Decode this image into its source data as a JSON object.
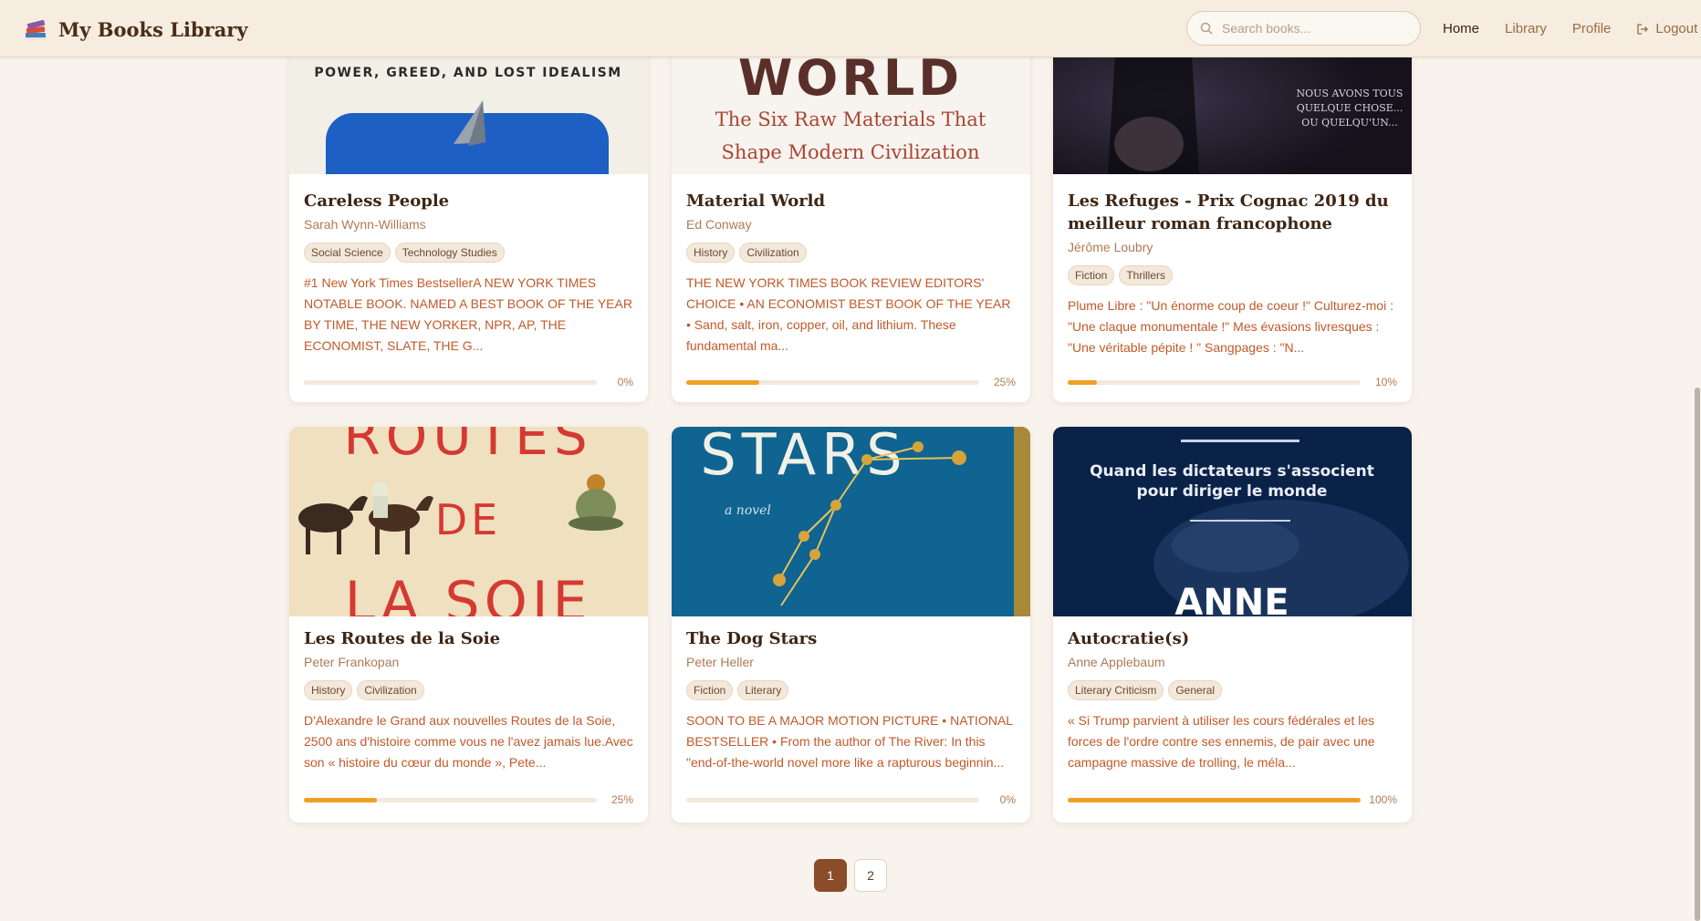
{
  "app": {
    "title": "My Books Library"
  },
  "search": {
    "placeholder": "Search books..."
  },
  "nav": [
    {
      "label": "Home",
      "active": true
    },
    {
      "label": "Library",
      "active": false
    },
    {
      "label": "Profile",
      "active": false
    },
    {
      "label": "Logout",
      "active": false,
      "icon": "logout-icon"
    }
  ],
  "books": [
    {
      "title": "Careless People",
      "author": "Sarah Wynn-Williams",
      "tags": [
        "Social Science",
        "Technology Studies"
      ],
      "description": "#1 New York Times BestsellerA NEW YORK TIMES NOTABLE BOOK. NAMED A BEST BOOK OF THE YEAR BY TIME, THE NEW YORKER, NPR, AP, THE ECONOMIST, SLATE, THE G...",
      "progress": 0,
      "progress_label": "0%",
      "cover_text": "POWER, GREED, AND LOST IDEALISM"
    },
    {
      "title": "Material World",
      "author": "Ed Conway",
      "tags": [
        "History",
        "Civilization"
      ],
      "description": "THE NEW YORK TIMES BOOK REVIEW EDITORS' CHOICE • AN ECONOMIST BEST BOOK OF THE YEAR • Sand, salt, iron, copper, oil, and lithium. These fundamental ma...",
      "progress": 25,
      "progress_label": "25%",
      "cover_text": "WORLD",
      "cover_subtitle": "The Six Raw Materials That Shape Modern Civilization"
    },
    {
      "title": "Les Refuges - Prix Cognac 2019 du meilleur roman francophone",
      "author": "Jérôme Loubry",
      "tags": [
        "Fiction",
        "Thrillers"
      ],
      "description": "Plume Libre : \"Un énorme coup de coeur !\" Culturez-moi : \"Une claque monumentale !\" Mes évasions livresques : \"Une véritable pépite ! \" Sangpages : \"N...",
      "progress": 10,
      "progress_label": "10%",
      "cover_text": "NOUS AVONS TOUS QUELQUE CHOSE... OU QUELQU'UN..."
    },
    {
      "title": "Les Routes de la Soie",
      "author": "Peter Frankopan",
      "tags": [
        "History",
        "Civilization"
      ],
      "description": "D'Alexandre le Grand aux nouvelles Routes de la Soie, 2500 ans d'histoire comme vous ne l'avez jamais lue.Avec son « histoire du cœur du monde », Pete...",
      "progress": 25,
      "progress_label": "25%",
      "cover_text": "ROUTES",
      "cover_text_2": "DE",
      "cover_text_3": "LA SOIE"
    },
    {
      "title": "The Dog Stars",
      "author": "Peter Heller",
      "tags": [
        "Fiction",
        "Literary"
      ],
      "description": "SOON TO BE A MAJOR MOTION PICTURE • NATIONAL BESTSELLER • From the author of The River: In this \"end-of-the-world novel more like a rapturous beginnin...",
      "progress": 0,
      "progress_label": "0%",
      "cover_text": "STARS",
      "cover_text_2": "a novel"
    },
    {
      "title": "Autocratie(s)",
      "author": "Anne Applebaum",
      "tags": [
        "Literary Criticism",
        "General"
      ],
      "description": "« Si Trump parvient à utiliser les cours fédérales et les forces de l'ordre contre ses ennemis, de pair avec une campagne massive de trolling, le méla...",
      "progress": 100,
      "progress_label": "100%",
      "cover_text": "Quand les dictateurs s'associent pour diriger le monde",
      "cover_text_2": "ANNE"
    }
  ],
  "pagination": {
    "pages": [
      "1",
      "2"
    ],
    "current": "1"
  },
  "colors": {
    "accent": "#8b4c2a",
    "progress": "#f0a020",
    "background": "#f8f3ec"
  }
}
